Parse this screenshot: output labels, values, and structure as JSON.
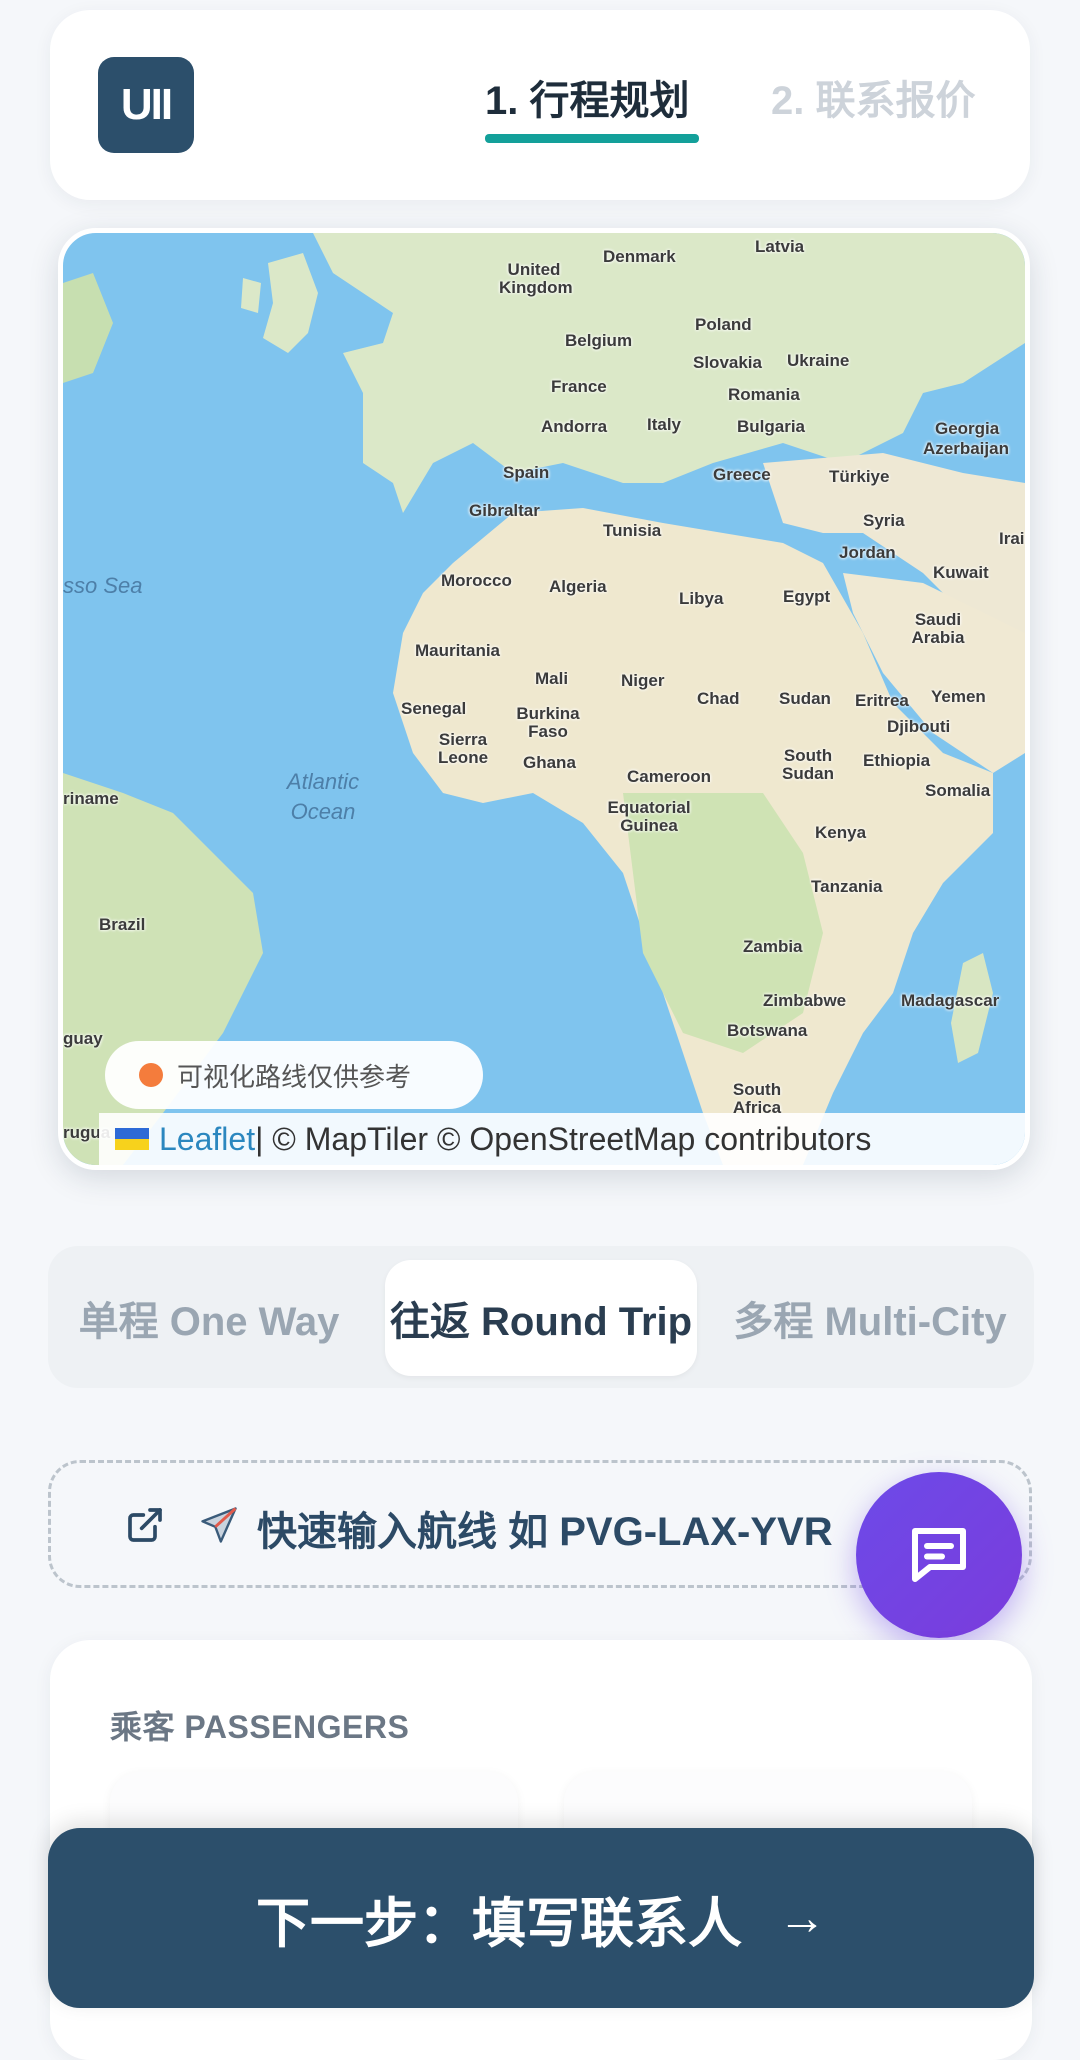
{
  "header": {
    "logo_text": "UII",
    "tabs": [
      {
        "label": "1. 行程规划",
        "active": true
      },
      {
        "label": "2. 联系报价",
        "active": false
      }
    ]
  },
  "map": {
    "labels": {
      "latvia": "Latvia",
      "denmark": "Denmark",
      "united_kingdom": "United Kingdom",
      "poland": "Poland",
      "belgium": "Belgium",
      "slovakia": "Slovakia",
      "ukraine": "Ukraine",
      "france": "France",
      "romania": "Romania",
      "andorra": "Andorra",
      "italy": "Italy",
      "bulgaria": "Bulgaria",
      "georgia": "Georgia",
      "azerbaijan": "Azerbaijan",
      "spain": "Spain",
      "greece": "Greece",
      "turkiye": "Türkiye",
      "gibraltar": "Gibraltar",
      "tunisia": "Tunisia",
      "syria": "Syria",
      "iran": "Irai",
      "jordan": "Jordan",
      "kuwait": "Kuwait",
      "sargasso": "sso Sea",
      "morocco": "Morocco",
      "algeria": "Algeria",
      "libya": "Libya",
      "egypt": "Egypt",
      "saudi": "Saudi Arabia",
      "mauritania": "Mauritania",
      "mali": "Mali",
      "niger": "Niger",
      "chad": "Chad",
      "sudan": "Sudan",
      "eritrea": "Eritrea",
      "yemen": "Yemen",
      "senegal": "Senegal",
      "burkina": "Burkina Faso",
      "djibouti": "Djibouti",
      "sierra": "Sierra Leone",
      "ghana": "Ghana",
      "atlantic": "Atlantic Ocean",
      "cameroon": "Cameroon",
      "south_sudan": "South Sudan",
      "ethiopia": "Ethiopia",
      "somalia": "Somalia",
      "suriname": "riname",
      "eq_guinea": "Equatorial Guinea",
      "kenya": "Kenya",
      "tanzania": "Tanzania",
      "brazil": "Brazil",
      "zambia": "Zambia",
      "zimbabwe": "Zimbabwe",
      "madagascar": "Madagascar",
      "botswana": "Botswana",
      "south_africa": "South Africa",
      "guay": "guay",
      "rugua": "rugua"
    },
    "route_note": "可视化路线仅供参考",
    "attribution_leaflet": "Leaflet",
    "attribution_rest": " | © MapTiler © OpenStreetMap contributors"
  },
  "trip_types": [
    {
      "label": "单程 One Way",
      "active": false
    },
    {
      "label": "往返 Round Trip",
      "active": true
    },
    {
      "label": "多程 Multi-City",
      "active": false
    }
  ],
  "quick_input": {
    "label": "快速输入航线 如 PVG-LAX-YVR"
  },
  "passengers": {
    "title": "乘客 PASSENGERS"
  },
  "next_button": {
    "label": "下一步：填写联系人",
    "arrow": "→"
  },
  "colors": {
    "primary": "#2c4f6b",
    "accent": "#13a09a",
    "chat": "#6d4ae8",
    "route_dot": "#f47c3c"
  },
  "icons": [
    "external-link-icon",
    "airplane-icon",
    "chat-icon",
    "arrow-right-icon"
  ]
}
